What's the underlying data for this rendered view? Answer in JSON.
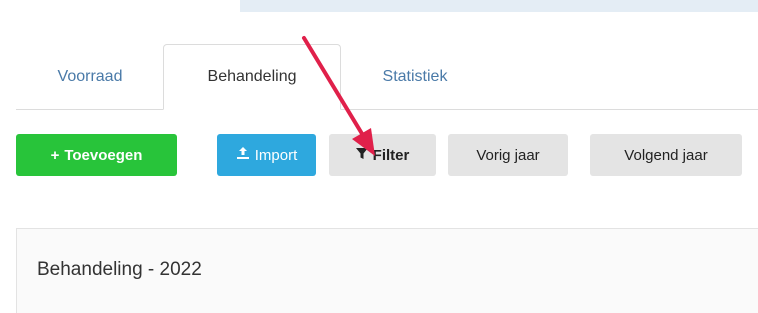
{
  "tabs": [
    {
      "label": "Voorraad",
      "active": false
    },
    {
      "label": "Behandeling",
      "active": true
    },
    {
      "label": "Statistiek",
      "active": false
    }
  ],
  "toolbar": {
    "add_label": "Toevoegen",
    "add_icon": "plus-icon",
    "import_label": "Import",
    "import_icon": "upload-icon",
    "filter_label": "Filter",
    "filter_icon": "filter-icon",
    "prev_year_label": "Vorig jaar",
    "next_year_label": "Volgend jaar"
  },
  "panel": {
    "title": "Behandeling - 2022"
  },
  "colors": {
    "add_button": "#28c43a",
    "import_button": "#2ea8de",
    "neutral_button": "#e4e4e4",
    "tab_link": "#4a7aa8",
    "annotation_arrow": "#e0204a"
  }
}
